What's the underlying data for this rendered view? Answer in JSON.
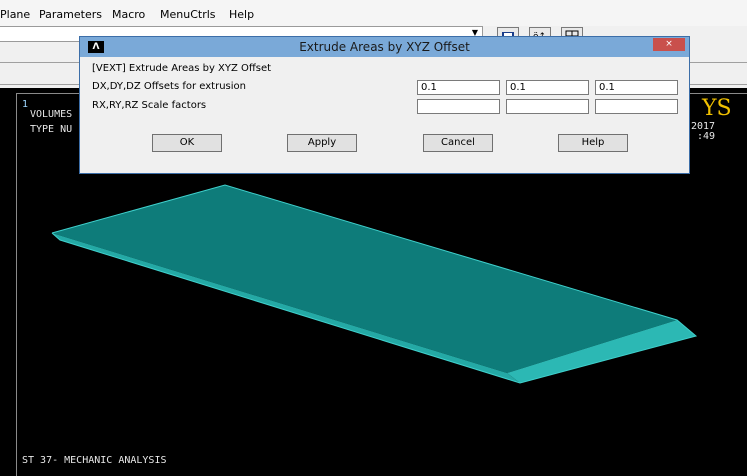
{
  "menu": {
    "items": [
      "Plane",
      "Parameters",
      "Macro",
      "MenuCtrls",
      "Help"
    ]
  },
  "graphics": {
    "window_number": "1",
    "line1": "VOLUMES",
    "line2": "TYPE NU",
    "logo_text": "YS",
    "date_text": "2017",
    "time_text": ":49",
    "footer": "ST 37- MECHANIC ANALYSIS",
    "shape_color": "#27a8a4",
    "shape_edge_color": "#3fd0cc"
  },
  "dialog": {
    "title": "Extrude Areas by XYZ Offset",
    "close_label": "×",
    "logo": "Λ",
    "header": "[VEXT]  Extrude Areas by XYZ Offset",
    "row1_label": "DX,DY,DZ  Offsets for extrusion",
    "row2_label": "RX,RY,RZ  Scale factors",
    "dx": "0.1",
    "dy": "0.1",
    "dz": "0.1",
    "rx": "",
    "ry": "",
    "rz": "",
    "ok_label": "OK",
    "apply_label": "Apply",
    "cancel_label": "Cancel",
    "help_label": "Help"
  }
}
